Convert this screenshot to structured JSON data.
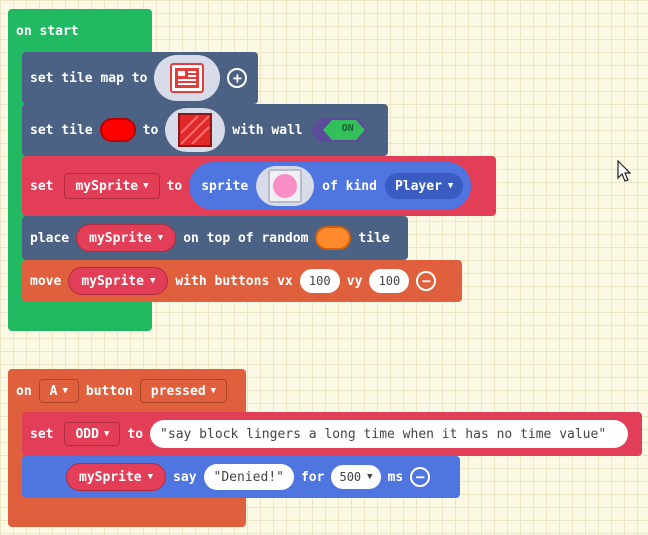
{
  "colors": {
    "start_green": "#21ba63",
    "tilemap_blue": "#4c6285",
    "sprite_red": "#e23e57",
    "controller_orange": "#e0603d",
    "sprite_royal_blue": "#4f75e0",
    "tile_red": "#ff0000",
    "tile_orange": "#ff8a2b",
    "sprite_pink": "#f78fc6"
  },
  "start_block": {
    "label": "on start",
    "set_tilemap": {
      "label": "set tile map to",
      "add_icon": "plus-circle-icon"
    },
    "set_tile": {
      "label": "set tile",
      "to": "to",
      "with_wall": "with wall",
      "toggle": "ON"
    },
    "set_sprite": {
      "label": "set",
      "variable": "mySprite",
      "to": "to",
      "sprite": "sprite",
      "of_kind": "of kind",
      "kind": "Player"
    },
    "place": {
      "label": "place",
      "variable": "mySprite",
      "on_top": "on top of random",
      "tile": "tile"
    },
    "move": {
      "label": "move",
      "variable": "mySprite",
      "with_buttons": "with buttons vx",
      "vx": "100",
      "vy_label": "vy",
      "vy": "100",
      "remove_icon": "minus-circle-icon"
    }
  },
  "event_block": {
    "on": "on",
    "button": "A",
    "button_label": "button",
    "event": "pressed",
    "set_var": {
      "label": "set",
      "variable": "ODD",
      "to": "to",
      "value": "\"say block lingers a long time when it has no time value\""
    },
    "say": {
      "variable": "mySprite",
      "say": "say",
      "text": "\"Denied!\"",
      "for": "for",
      "duration": "500",
      "unit": "ms",
      "remove_icon": "minus-circle-icon"
    }
  }
}
